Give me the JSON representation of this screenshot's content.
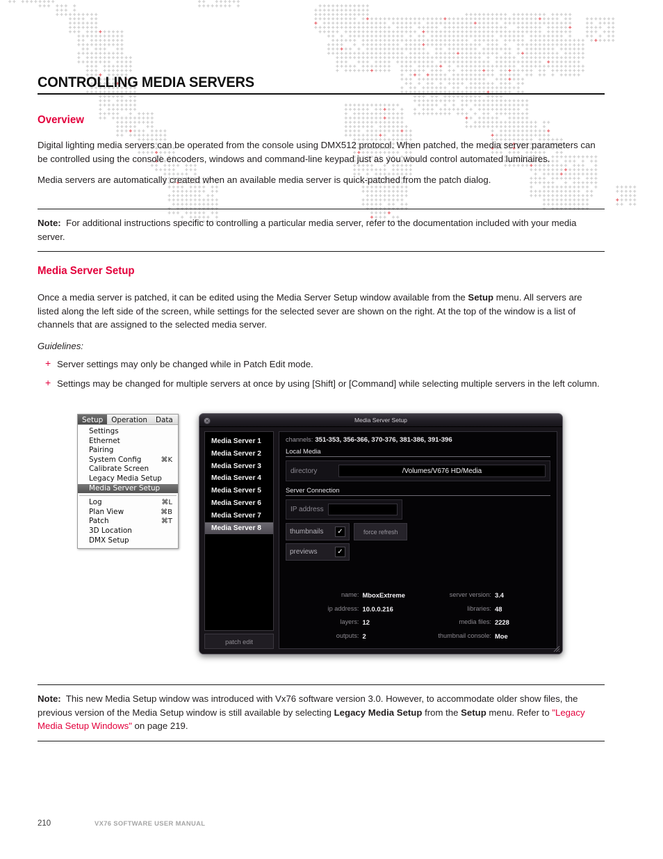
{
  "document": {
    "title": "CONTROLLING MEDIA SERVERS",
    "sections": {
      "overview_heading": "Overview",
      "overview_p1": "Digital lighting media servers can be operated from the console using DMX512 protocol. When patched, the media server parameters can be controlled using the console encoders, windows and command-line keypad just as you would control automated luminaires.",
      "overview_p2": "Media servers are automatically created when an available media server is quick-patched from the patch dialog.",
      "note1_label": "Note:",
      "note1_text": "For additional instructions specific to controlling a particular media server, refer to the documentation included with your media server.",
      "setup_heading": "Media Server Setup",
      "setup_p1_a": "Once a media server is patched, it can be edited using the Media Server Setup window available from the ",
      "setup_p1_bold": "Setup",
      "setup_p1_b": " menu. All servers are listed along the left side of the screen, while settings for the selected sever are shown on the right. At the top of the window is a list of channels that are assigned to the selected media server.",
      "guidelines_label": "Guidelines:",
      "guidelines": [
        "Server settings may only be changed while in Patch Edit mode.",
        "Settings may be changed for multiple servers at once by using [Shift] or [Command] while selecting multiple servers in the left column."
      ],
      "note2_label": "Note:",
      "note2_a": "This new Media Setup window was introduced with Vx76 software version 3.0. However, to accommodate older show files, the previous version of the Media Setup window is still available by selecting ",
      "note2_bold1": "Legacy Media Setup",
      "note2_b": " from the ",
      "note2_bold2": "Setup",
      "note2_c": " menu. Refer to ",
      "note2_link": "\"Legacy Media Setup Windows\"",
      "note2_d": " on page 219."
    },
    "footer": {
      "page_number": "210",
      "manual_title": "VX76 SOFTWARE USER MANUAL"
    }
  },
  "figure": {
    "menu": {
      "menubar": [
        {
          "label": "Setup",
          "active": true
        },
        {
          "label": "Operation",
          "active": false
        },
        {
          "label": "Data",
          "active": false
        }
      ],
      "group1": [
        {
          "label": "Settings",
          "shortcut": "",
          "selected": false
        },
        {
          "label": "Ethernet",
          "shortcut": "",
          "selected": false
        },
        {
          "label": "Pairing",
          "shortcut": "",
          "selected": false
        },
        {
          "label": "System Config",
          "shortcut": "⌘K",
          "selected": false
        },
        {
          "label": "Calibrate Screen",
          "shortcut": "",
          "selected": false
        },
        {
          "label": "Legacy Media Setup",
          "shortcut": "",
          "selected": false
        },
        {
          "label": "Media Server Setup",
          "shortcut": "",
          "selected": true
        }
      ],
      "group2": [
        {
          "label": "Log",
          "shortcut": "⌘L",
          "selected": false
        },
        {
          "label": "Plan View",
          "shortcut": "⌘B",
          "selected": false
        },
        {
          "label": "Patch",
          "shortcut": "⌘T",
          "selected": false
        },
        {
          "label": "3D Location",
          "shortcut": "",
          "selected": false
        },
        {
          "label": "DMX Setup",
          "shortcut": "",
          "selected": false
        }
      ]
    },
    "dialog": {
      "title": "Media Server Setup",
      "close_icon": "✕",
      "servers": [
        {
          "label": "Media Server 1",
          "selected": false
        },
        {
          "label": "Media Server 2",
          "selected": false
        },
        {
          "label": "Media Server 3",
          "selected": false
        },
        {
          "label": "Media Server 4",
          "selected": false
        },
        {
          "label": "Media Server 5",
          "selected": false
        },
        {
          "label": "Media Server 6",
          "selected": false
        },
        {
          "label": "Media Server 7",
          "selected": false
        },
        {
          "label": "Media Server 8",
          "selected": true
        }
      ],
      "patch_edit_label": "patch edit",
      "channels_label": "channels:",
      "channels_value": "351-353, 356-366, 370-376, 381-386, 391-396",
      "local_media_label": "Local Media",
      "directory_label": "directory",
      "directory_value": "/Volumes/V676 HD/Media",
      "server_connection_label": "Server Connection",
      "ip_address_label": "IP address",
      "ip_address_value": "",
      "thumbnails_label": "thumbnails",
      "thumbnails_checked": "✓",
      "previews_label": "previews",
      "previews_checked": "✓",
      "force_refresh_label": "force refresh",
      "details_left": [
        {
          "key": "name:",
          "value": "MboxExtreme"
        },
        {
          "key": "ip address:",
          "value": "10.0.0.216"
        },
        {
          "key": "layers:",
          "value": "12"
        },
        {
          "key": "outputs:",
          "value": "2"
        }
      ],
      "details_right": [
        {
          "key": "server version:",
          "value": "3.4"
        },
        {
          "key": "libraries:",
          "value": "48"
        },
        {
          "key": "media files:",
          "value": "2228"
        },
        {
          "key": "thumbnail console:",
          "value": "Moe"
        }
      ]
    }
  },
  "colors": {
    "accent_red": "#e3003c",
    "text": "#231f20",
    "map_dot": "#cfcfcf",
    "map_dot_red": "#e8686f"
  }
}
